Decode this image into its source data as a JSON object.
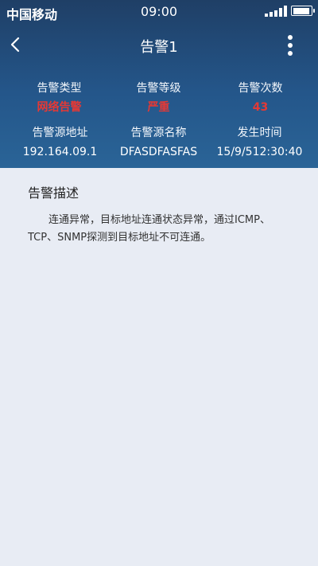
{
  "status_bar": {
    "carrier": "中国移动",
    "time": "09:00",
    "signal_icon": "signal-bars-icon",
    "battery_icon": "battery-icon"
  },
  "nav": {
    "back_icon": "back-chevron-icon",
    "title": "告警1",
    "more_icon": "more-vertical-icon"
  },
  "info": {
    "row1": [
      {
        "label": "告警类型",
        "value": "网络告警",
        "highlight": true
      },
      {
        "label": "告警等级",
        "value": "严重",
        "highlight": true
      },
      {
        "label": "告警次数",
        "value": "43",
        "highlight": true
      }
    ],
    "row2": [
      {
        "label": "告警源地址",
        "value": "192.164.09.1",
        "highlight": false
      },
      {
        "label": "告警源名称",
        "value": "DFASDFASFAS",
        "highlight": false
      },
      {
        "label": "发生时间",
        "value": "15/9/512:30:40",
        "highlight": false
      }
    ]
  },
  "description": {
    "title": "告警描述",
    "text": "连通异常，目标地址连通状态异常，通过ICMP、TCP、SNMP探测到目标地址不可连通。"
  },
  "colors": {
    "header_top": "#1f3f66",
    "header_bottom": "#2a6497",
    "highlight": "#e53935",
    "background": "#e8ecf4"
  }
}
